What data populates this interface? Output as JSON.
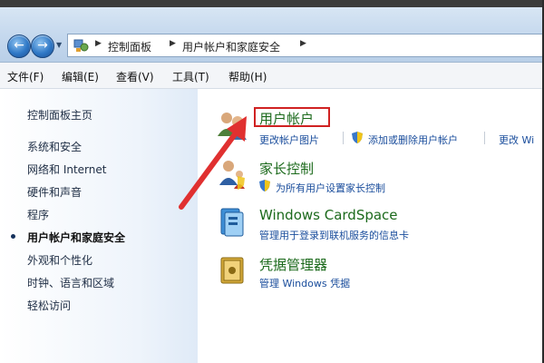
{
  "breadcrumb": {
    "items": [
      "控制面板",
      "用户帐户和家庭安全"
    ]
  },
  "menu": {
    "items": [
      "文件(F)",
      "编辑(E)",
      "查看(V)",
      "工具(T)",
      "帮助(H)"
    ]
  },
  "sidebar": {
    "home": "控制面板主页",
    "items": [
      {
        "label": "系统和安全",
        "active": false
      },
      {
        "label": "网络和 Internet",
        "active": false
      },
      {
        "label": "硬件和声音",
        "active": false
      },
      {
        "label": "程序",
        "active": false
      },
      {
        "label": "用户帐户和家庭安全",
        "active": true
      },
      {
        "label": "外观和个性化",
        "active": false
      },
      {
        "label": "时钟、语言和区域",
        "active": false
      },
      {
        "label": "轻松访问",
        "active": false
      }
    ]
  },
  "categories": [
    {
      "title": "用户帐户",
      "icon": "users-icon",
      "links": [
        "更改帐户图片",
        "添加或删除用户帐户",
        "更改 Wi"
      ]
    },
    {
      "title": "家长控制",
      "icon": "parental-control-icon",
      "links": [
        "为所有用户设置家长控制"
      ]
    },
    {
      "title": "Windows CardSpace",
      "icon": "cardspace-icon",
      "links": [
        "管理用于登录到联机服务的信息卡"
      ]
    },
    {
      "title": "凭据管理器",
      "icon": "credential-manager-icon",
      "links": [
        "管理 Windows 凭据"
      ]
    }
  ],
  "colors": {
    "highlight": "#d02222",
    "category_title": "#1c6a1c",
    "link": "#1a4d9c"
  }
}
